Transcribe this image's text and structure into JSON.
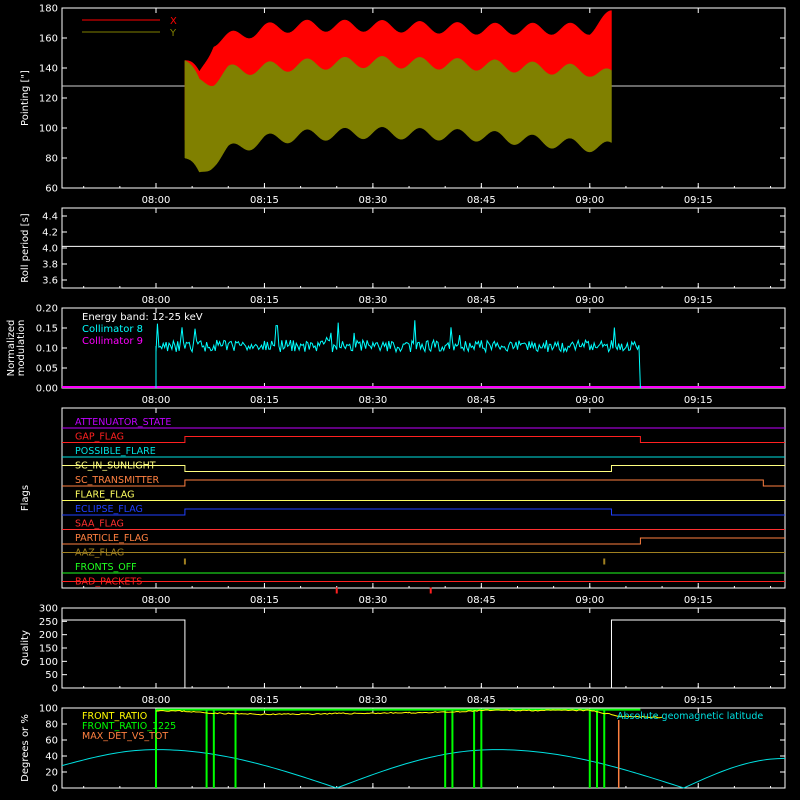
{
  "colors": {
    "bg": "#000000",
    "axis": "#ffffff",
    "x": "#ff0000",
    "y": "#808000",
    "mean": "#cfcfcf",
    "coll8": "#00ffff",
    "coll9": "#ff00ff",
    "quality": "#ffffff",
    "front_ratio": "#ffff00",
    "front_ratio_1225": "#00ff00",
    "max_det": "#ff8040",
    "lat": "#00e0e0"
  },
  "time_ticks": [
    "08:00",
    "08:15",
    "08:30",
    "08:45",
    "09:00",
    "09:15"
  ],
  "chart_data": [
    {
      "id": "pointing",
      "type": "line",
      "ylabel": "Pointing [\"]",
      "ylim": [
        60,
        180
      ],
      "yticks": [
        "60",
        "80",
        "100",
        "120",
        "140",
        "160",
        "180"
      ],
      "xlim": [
        "07:47",
        "09:27"
      ],
      "legend": [
        {
          "name": "X",
          "color": "#ff0000"
        },
        {
          "name": "Y",
          "color": "#808000"
        }
      ],
      "reference_line": 128,
      "time_range": [
        "08:04",
        "09:03"
      ],
      "series": [
        {
          "name": "X",
          "x": [
            "08:04",
            "08:06",
            "08:08",
            "08:10",
            "08:15",
            "08:20",
            "08:30",
            "08:45",
            "09:00",
            "09:03"
          ],
          "max": [
            145,
            135,
            158,
            160,
            166,
            168,
            168,
            166,
            166,
            175
          ],
          "min": [
            92,
            70,
            100,
            115,
            125,
            130,
            135,
            133,
            135,
            135
          ]
        },
        {
          "name": "Y",
          "x": [
            "08:04",
            "08:06",
            "08:08",
            "08:10",
            "08:15",
            "08:20",
            "08:30",
            "08:45",
            "09:00",
            "09:03"
          ],
          "max": [
            145,
            130,
            132,
            138,
            140,
            142,
            144,
            142,
            138,
            135
          ],
          "min": [
            80,
            68,
            78,
            85,
            92,
            95,
            97,
            95,
            88,
            87
          ]
        }
      ]
    },
    {
      "id": "roll",
      "type": "line",
      "ylabel": "Roll period [s]",
      "ylim": [
        3.5,
        4.5
      ],
      "yticks": [
        "3.6",
        "3.8",
        "4.0",
        "4.2",
        "4.4"
      ],
      "series": [
        {
          "x": [
            "07:47",
            "09:27"
          ],
          "values": [
            4.02,
            4.02
          ]
        }
      ]
    },
    {
      "id": "modulation",
      "type": "line",
      "ylabel": [
        "Normalized",
        "modulation"
      ],
      "ylim": [
        0,
        0.2
      ],
      "yticks": [
        "0.00",
        "0.05",
        "0.10",
        "0.15",
        "0.20"
      ],
      "annotation": "Energy band: 12-25 keV",
      "legend": [
        {
          "name": "Collimator 8",
          "color": "#00ffff"
        },
        {
          "name": "Collimator 9",
          "color": "#ff00ff"
        }
      ],
      "series": [
        {
          "name": "Collimator 8",
          "x_start": "08:00",
          "x_end": "09:07",
          "base": 0.105,
          "spread": 0.03,
          "max": 0.17
        },
        {
          "name": "Collimator 9",
          "x": [
            "07:47",
            "09:27"
          ],
          "values": [
            0,
            0
          ]
        }
      ]
    },
    {
      "id": "flags",
      "type": "line",
      "ylabel": "Flags",
      "flags": [
        {
          "name": "ATTENUATOR_STATE",
          "color": "#c000ff",
          "segments": [
            [
              "07:47",
              "09:27",
              0
            ]
          ]
        },
        {
          "name": "GAP_FLAG",
          "color": "#ff2020",
          "segments": [
            [
              "07:47",
              "08:04",
              0
            ],
            [
              "08:04",
              "09:07",
              -1
            ],
            [
              "09:07",
              "09:27",
              0
            ]
          ]
        },
        {
          "name": "POSSIBLE_FLARE",
          "color": "#00e0e0",
          "segments": [
            [
              "07:47",
              "09:27",
              0
            ]
          ]
        },
        {
          "name": "SC_IN_SUNLIGHT",
          "color": "#ffff80",
          "segments": [
            [
              "07:47",
              "08:04",
              -1
            ],
            [
              "08:04",
              "09:03",
              0
            ],
            [
              "09:03",
              "09:27",
              -1
            ]
          ]
        },
        {
          "name": "SC_TRANSMITTER",
          "color": "#ff8040",
          "segments": [
            [
              "07:47",
              "08:04",
              0
            ],
            [
              "08:04",
              "09:24",
              -1
            ],
            [
              "09:24",
              "09:27",
              0
            ]
          ]
        },
        {
          "name": "FLARE_FLAG",
          "color": "#ffff60",
          "segments": [
            [
              "07:47",
              "09:27",
              0
            ]
          ]
        },
        {
          "name": "ECLIPSE_FLAG",
          "color": "#2040ff",
          "segments": [
            [
              "07:47",
              "08:04",
              0
            ],
            [
              "08:04",
              "09:03",
              -1
            ],
            [
              "09:03",
              "09:27",
              0
            ]
          ]
        },
        {
          "name": "SAA_FLAG",
          "color": "#ff3030",
          "segments": [
            [
              "07:47",
              "09:27",
              0
            ]
          ]
        },
        {
          "name": "PARTICLE_FLAG",
          "color": "#ff8040",
          "segments": [
            [
              "07:47",
              "09:07",
              0
            ],
            [
              "09:07",
              "09:27",
              -1
            ]
          ]
        },
        {
          "name": "AAZ_FLAG",
          "color": "#a08020",
          "segments": [
            [
              "07:47",
              "09:27",
              -1
            ]
          ],
          "spikes": [
            "08:04",
            "09:02"
          ]
        },
        {
          "name": "FRONTS_OFF",
          "color": "#20ff20",
          "segments": [
            [
              "07:47",
              "09:27",
              0
            ]
          ]
        },
        {
          "name": "BAD_PACKETS",
          "color": "#ff2020",
          "segments": [
            [
              "07:47",
              "09:27",
              -1
            ]
          ],
          "spikes": [
            "08:25",
            "08:38"
          ]
        }
      ]
    },
    {
      "id": "quality",
      "type": "line",
      "ylabel": "Quality",
      "ylim": [
        0,
        300
      ],
      "yticks": [
        "0",
        "50",
        "100",
        "150",
        "200",
        "250",
        "300"
      ],
      "series": [
        {
          "x": [
            "07:47",
            "08:04",
            "08:04",
            "09:03",
            "09:03",
            "09:27"
          ],
          "values": [
            255,
            255,
            0,
            0,
            255,
            255
          ]
        }
      ]
    },
    {
      "id": "degrees",
      "type": "line",
      "ylabel": "Degrees or %",
      "ylim": [
        0,
        100
      ],
      "yticks": [
        "0",
        "20",
        "40",
        "60",
        "80",
        "100"
      ],
      "legend": [
        {
          "name": "FRONT_RATIO",
          "color": "#ffff00"
        },
        {
          "name": "FRONT_RATIO_1225",
          "color": "#00ff00"
        },
        {
          "name": "MAX_DET_VS_TOT",
          "color": "#ff8040"
        }
      ],
      "annotation": "Absolute geomagnetic latitude",
      "series": [
        {
          "name": "FRONT_RATIO",
          "x": [
            "08:00",
            "08:04",
            "08:07",
            "08:10",
            "08:15",
            "08:25",
            "08:35",
            "08:42",
            "08:45",
            "09:00",
            "09:04",
            "09:10"
          ],
          "values": [
            97,
            96,
            94,
            93,
            92,
            93,
            94,
            95,
            97,
            97,
            90,
            88
          ]
        },
        {
          "name": "FRONT_RATIO_1225",
          "x_start": "08:00",
          "x_end": "09:07",
          "value": 98,
          "drops": [
            "08:00",
            "08:07",
            "08:08",
            "08:11",
            "08:40",
            "08:41",
            "08:44",
            "08:45",
            "09:00",
            "09:01",
            "09:02"
          ]
        },
        {
          "name": "Absolute geomagnetic latitude",
          "x": [
            "07:47",
            "08:00",
            "08:25",
            "08:47",
            "09:13",
            "09:27"
          ],
          "values": [
            28,
            48,
            0,
            48,
            0,
            37
          ]
        }
      ]
    }
  ]
}
